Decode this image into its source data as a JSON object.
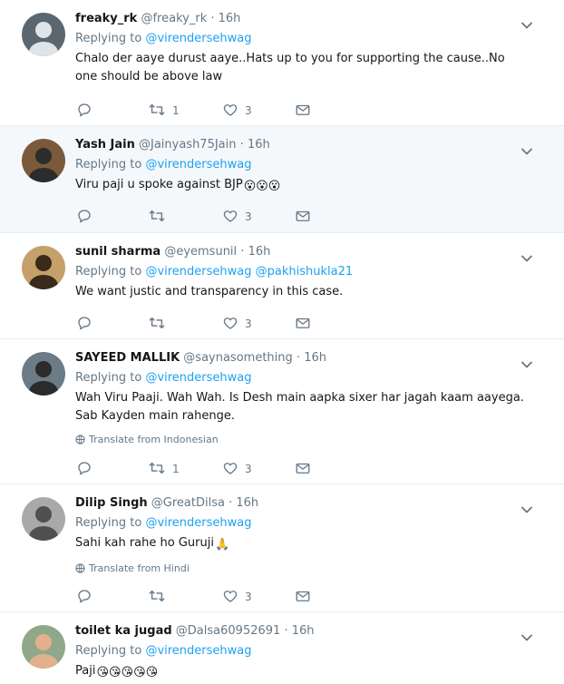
{
  "tweets": [
    {
      "name": "freaky_rk",
      "handle": "@freaky_rk",
      "dot": "·",
      "time": "16h",
      "replying_prefix": "Replying to",
      "mentions": "@virendersehwag",
      "text": "Chalo der aaye durust aaye..Hats up to you for supporting the cause..No one should be  above law",
      "emojis": "",
      "translate": "",
      "retweets": "1",
      "likes": "3"
    },
    {
      "name": "Yash Jain",
      "handle": "@Jainyash75Jain",
      "dot": "·",
      "time": "16h",
      "replying_prefix": "Replying to",
      "mentions": "@virendersehwag",
      "text": "Viru paji u spoke against BJP",
      "emojis": "😮😮😮",
      "translate": "",
      "retweets": "",
      "likes": "3"
    },
    {
      "name": "sunil sharma",
      "handle": "@eyemsunil",
      "dot": "·",
      "time": "16h",
      "replying_prefix": "Replying to",
      "mentions": "@virendersehwag @pakhishukla21",
      "text": "We want justic and transparency in this case.",
      "emojis": "",
      "translate": "",
      "retweets": "",
      "likes": "3"
    },
    {
      "name": "SAYEED MALLIK",
      "handle": "@saynasomething",
      "dot": "·",
      "time": "16h",
      "replying_prefix": "Replying to",
      "mentions": "@virendersehwag",
      "text": "Wah Viru Paaji. Wah Wah. Is Desh main aapka sixer har jagah kaam aayega. Sab Kayden main rahenge.",
      "emojis": "",
      "translate": "Translate from Indonesian",
      "retweets": "1",
      "likes": "3"
    },
    {
      "name": "Dilip Singh",
      "handle": "@GreatDilsa",
      "dot": "·",
      "time": "16h",
      "replying_prefix": "Replying to",
      "mentions": "@virendersehwag",
      "text": "Sahi kah rahe ho Guruji",
      "emojis": "🙏",
      "translate": "Translate from Hindi",
      "retweets": "",
      "likes": "3"
    },
    {
      "name": "toilet ka jugad",
      "handle": "@Dalsa60952691",
      "dot": "·",
      "time": "16h",
      "replying_prefix": "Replying to",
      "mentions": "@virendersehwag",
      "text": "Paji",
      "emojis": "😘😘😘😘😘",
      "translate": "",
      "retweets": "",
      "likes": ""
    }
  ],
  "icons": {
    "reply": "reply-icon",
    "retweet": "retweet-icon",
    "like": "heart-icon",
    "dm": "envelope-icon",
    "caret": "chevron-down-icon",
    "globe": "globe-icon"
  },
  "colors": {
    "link": "#1da1f2",
    "muted": "#657786",
    "highlight_bg": "#f5f8fa",
    "divider": "#e6ecf0"
  }
}
